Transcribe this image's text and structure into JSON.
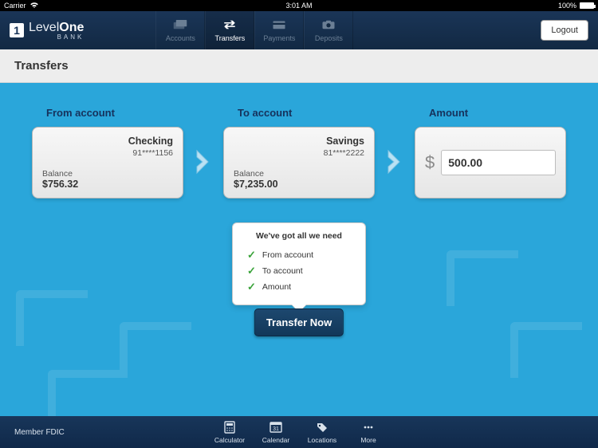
{
  "status": {
    "carrier": "Carrier",
    "time": "3:01 AM",
    "battery": "100%"
  },
  "header": {
    "logo_light": "Level",
    "logo_bold": "One",
    "logo_sub": "BANK",
    "tabs": [
      {
        "label": "Accounts"
      },
      {
        "label": "Transfers"
      },
      {
        "label": "Payments"
      },
      {
        "label": "Deposits"
      }
    ],
    "logout": "Logout"
  },
  "page_title": "Transfers",
  "transfer": {
    "from_label": "From account",
    "to_label": "To account",
    "amount_label": "Amount",
    "from": {
      "name": "Checking",
      "masked": "91****1156",
      "balance_label": "Balance",
      "balance": "$756.32"
    },
    "to": {
      "name": "Savings",
      "masked": "81****2222",
      "balance_label": "Balance",
      "balance": "$7,235.00"
    },
    "amount": {
      "currency": "$",
      "value": "500.00"
    }
  },
  "popover": {
    "title": "We've got all we need",
    "items": [
      "From account",
      "To account",
      "Amount"
    ]
  },
  "cta": "Transfer Now",
  "footer": {
    "member": "Member FDIC",
    "tabs": [
      {
        "label": "Calculator"
      },
      {
        "label": "Calendar"
      },
      {
        "label": "Locations"
      },
      {
        "label": "More"
      }
    ]
  }
}
